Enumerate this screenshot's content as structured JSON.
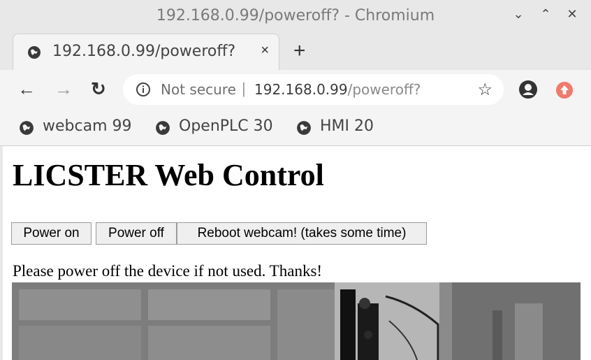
{
  "window": {
    "title": "192.168.0.99/poweroff? - Chromium",
    "controls": {
      "minimize": "⌄",
      "maximize": "⌃",
      "close": "✕"
    }
  },
  "tab": {
    "title": "192.168.0.99/poweroff?",
    "close_label": "×",
    "icon": "globe-icon"
  },
  "new_tab_label": "+",
  "toolbar": {
    "back": "←",
    "forward": "→",
    "reload": "↻"
  },
  "omnibox": {
    "security": "Not secure",
    "separator": "|",
    "host": "192.168.0.99",
    "path": "/poweroff?"
  },
  "bookmarks": [
    {
      "label": "webcam 99",
      "icon": "globe-icon"
    },
    {
      "label": "OpenPLC 30",
      "icon": "globe-icon"
    },
    {
      "label": "HMI 20",
      "icon": "globe-icon"
    }
  ],
  "page": {
    "heading": "LICSTER Web Control",
    "buttons": {
      "power_on": "Power on",
      "power_off": "Power off",
      "reboot": "Reboot webcam! (takes some time)"
    },
    "notice": "Please power off the device if not used. Thanks!"
  },
  "colors": {
    "chrome_bg": "#e8e8e8",
    "tab_bg": "#f4f4f4",
    "update_badge": "#f07a6b"
  }
}
